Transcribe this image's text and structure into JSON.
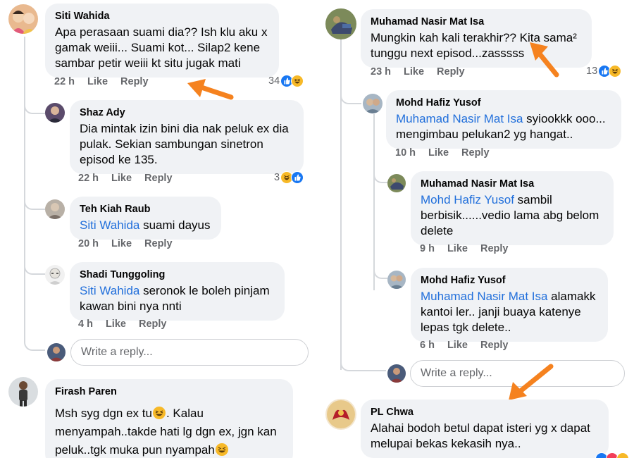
{
  "left": {
    "c1": {
      "name": "Siti Wahida",
      "text": "Apa perasaan suami dia?? Ish klu aku x gamak weiii... Suami kot... Silap2 kene sambar petir weiii kt situ jugak mati",
      "time": "22 h",
      "like": "Like",
      "reply": "Reply",
      "count": "34"
    },
    "r1": {
      "name": "Shaz Ady",
      "text": "Dia mintak izin bini dia nak peluk ex dia pulak. Sekian sambungan sinetron episod ke 135.",
      "time": "22 h",
      "like": "Like",
      "reply": "Reply",
      "count": "3"
    },
    "r2": {
      "name": "Teh Kiah Raub",
      "mention": "Siti Wahida",
      "text": " suami dayus",
      "time": "20 h",
      "like": "Like",
      "reply": "Reply"
    },
    "r3": {
      "name": "Shadi Tunggoling",
      "mention": "Siti Wahida",
      "text": " seronok le boleh pinjam kawan bini nya nnti",
      "time": "4 h",
      "like": "Like",
      "reply": "Reply"
    },
    "reply_placeholder": "Write a reply...",
    "c2": {
      "name": "Firash Paren",
      "line1": "Msh syg dgn ex tu",
      "line1b": ". Kalau",
      "line2": "menyampah..takde hati lg dgn ex, jgn kan",
      "line3": "peluk..tgk muka pun nyampah"
    }
  },
  "right": {
    "c1": {
      "name": "Muhamad Nasir Mat Isa",
      "text": "Mungkin kah kali terakhir?? Kita sama² tunggu next episod...zasssss",
      "time": "23 h",
      "like": "Like",
      "reply": "Reply",
      "count": "13"
    },
    "r1": {
      "name": "Mohd Hafiz Yusof",
      "mention": "Muhamad Nasir Mat Isa",
      "text": " syiookkk ooo... mengimbau pelukan2 yg hangat..",
      "time": "10 h",
      "like": "Like",
      "reply": "Reply"
    },
    "r2": {
      "name": "Muhamad Nasir Mat Isa",
      "mention": "Mohd Hafiz Yusof",
      "text": " sambil berbisik......vedio lama abg belom delete",
      "time": "9 h",
      "like": "Like",
      "reply": "Reply"
    },
    "r3": {
      "name": "Mohd Hafiz Yusof",
      "mention": "Muhamad Nasir Mat Isa",
      "text": " alamakk kantoi ler.. janji buaya katenye lepas tgk delete..",
      "time": "6 h",
      "like": "Like",
      "reply": "Reply"
    },
    "reply_placeholder": "Write a reply...",
    "c2": {
      "name": "PL Chwa",
      "text": "Alahai bodoh betul dapat isteri yg x dapat melupai bekas kekasih nya.."
    }
  },
  "colors": {
    "like_blue": "#1877f2",
    "haha_yellow": "#f7b928",
    "mention_blue": "#216fdb",
    "arrow_orange": "#f5821f"
  },
  "icons": [
    "like-reaction-icon",
    "haha-reaction-icon",
    "grinning-squint-emoji",
    "arrow-annotation"
  ]
}
